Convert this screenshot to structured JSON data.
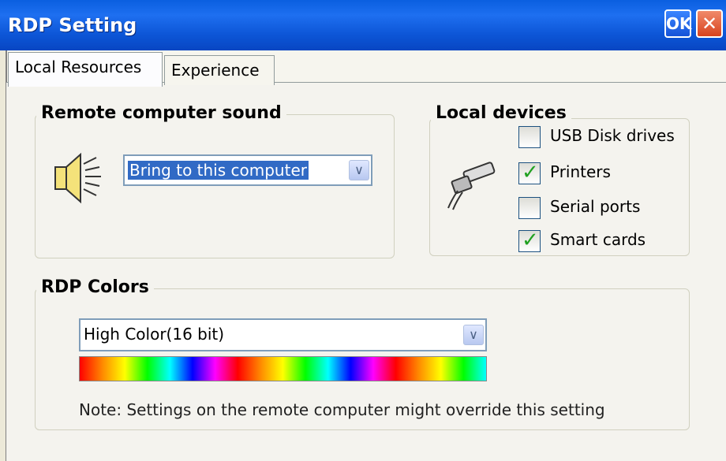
{
  "window": {
    "title": "RDP Setting",
    "ok_label": "OK",
    "close_label": "✕"
  },
  "tabs": [
    {
      "label": "Local Resources",
      "active": true
    },
    {
      "label": "Experience",
      "active": false
    }
  ],
  "sound_group": {
    "label": "Remote computer sound",
    "select": {
      "value": "Bring to this computer"
    },
    "icon": "speaker-icon"
  },
  "devices_group": {
    "label": "Local devices",
    "icon": "cable-plug-icon",
    "items": [
      {
        "label": "USB Disk drives",
        "checked": false
      },
      {
        "label": "Printers",
        "checked": true
      },
      {
        "label": "Serial ports",
        "checked": false
      },
      {
        "label": "Smart cards",
        "checked": true
      }
    ]
  },
  "colors_group": {
    "label": "RDP Colors",
    "select": {
      "value": "High Color(16 bit)"
    },
    "note": "Note: Settings on the remote computer might  override this setting"
  },
  "colors": {
    "titlebar": "#0c55d6",
    "ok_button": "#1553d8",
    "close_button": "#d8431f",
    "check": "#21a121",
    "selection": "#316ac5"
  }
}
